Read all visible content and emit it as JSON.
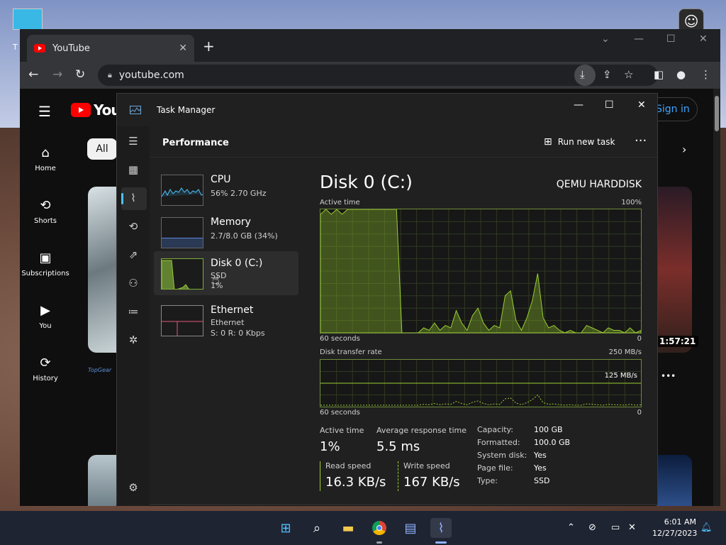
{
  "desktop": {
    "icon_label": "T"
  },
  "chrome": {
    "tab_title": "YouTube",
    "tab_close": "✕",
    "new_tab": "+",
    "url": "youtube.com",
    "win_min": "—",
    "win_max": "☐",
    "win_close": "✕",
    "win_search": "⌄"
  },
  "youtube": {
    "logo_text": "YouT",
    "chip_all": "All",
    "sign_in": "Sign in",
    "nav": [
      {
        "label": "Home",
        "icon": "⌂"
      },
      {
        "label": "Shorts",
        "icon": "⟲"
      },
      {
        "label": "Subscriptions",
        "icon": "▣"
      },
      {
        "label": "You",
        "icon": "▶"
      },
      {
        "label": "History",
        "icon": "⟳"
      }
    ],
    "duration": "1:57:21",
    "channel": "TopGear"
  },
  "taskmanager": {
    "title": "Task Manager",
    "section": "Performance",
    "run_new_task": "Run new task",
    "items": [
      {
        "title": "CPU",
        "sub1": "56% 2.70 GHz",
        "sub2": ""
      },
      {
        "title": "Memory",
        "sub1": "2.7/8.0 GB (34%)",
        "sub2": ""
      },
      {
        "title": "Disk 0 (C:)",
        "sub1": "SSD",
        "sub2": "1%"
      },
      {
        "title": "Ethernet",
        "sub1": "Ethernet",
        "sub2": "S: 0 R: 0 Kbps"
      }
    ],
    "disk_title": "Disk 0 (C:)",
    "disk_model": "QEMU HARDDISK",
    "active_time_caption": "Active time",
    "active_time_max": "100%",
    "graph1_left": "60 seconds",
    "graph1_right": "0",
    "transfer_caption": "Disk transfer rate",
    "transfer_max": "250 MB/s",
    "transfer_mid": "125 MB/s",
    "graph2_left": "60 seconds",
    "graph2_right": "0",
    "stats": {
      "active_time_label": "Active time",
      "active_time_value": "1%",
      "avg_resp_label": "Average response time",
      "avg_resp_value": "5.5 ms",
      "read_label": "Read speed",
      "read_value": "16.3 KB/s",
      "write_label": "Write speed",
      "write_value": "167 KB/s"
    },
    "props": [
      {
        "k": "Capacity:",
        "v": "100 GB"
      },
      {
        "k": "Formatted:",
        "v": "100.0 GB"
      },
      {
        "k": "System disk:",
        "v": "Yes"
      },
      {
        "k": "Page file:",
        "v": "Yes"
      },
      {
        "k": "Type:",
        "v": "SSD"
      }
    ],
    "active_series": [
      96,
      100,
      96,
      100,
      96,
      100,
      100,
      100,
      100,
      100,
      100,
      100,
      100,
      100,
      100,
      0,
      0,
      0,
      0,
      4,
      2,
      8,
      2,
      6,
      4,
      18,
      8,
      2,
      14,
      20,
      8,
      2,
      6,
      4,
      30,
      34,
      10,
      2,
      12,
      26,
      48,
      12,
      4,
      6,
      2,
      0,
      2,
      0,
      0,
      6,
      4,
      2,
      0,
      4,
      2,
      2,
      0,
      4,
      0,
      2
    ]
  },
  "taskbar": {
    "time": "6:01 AM",
    "date": "12/27/2023"
  }
}
